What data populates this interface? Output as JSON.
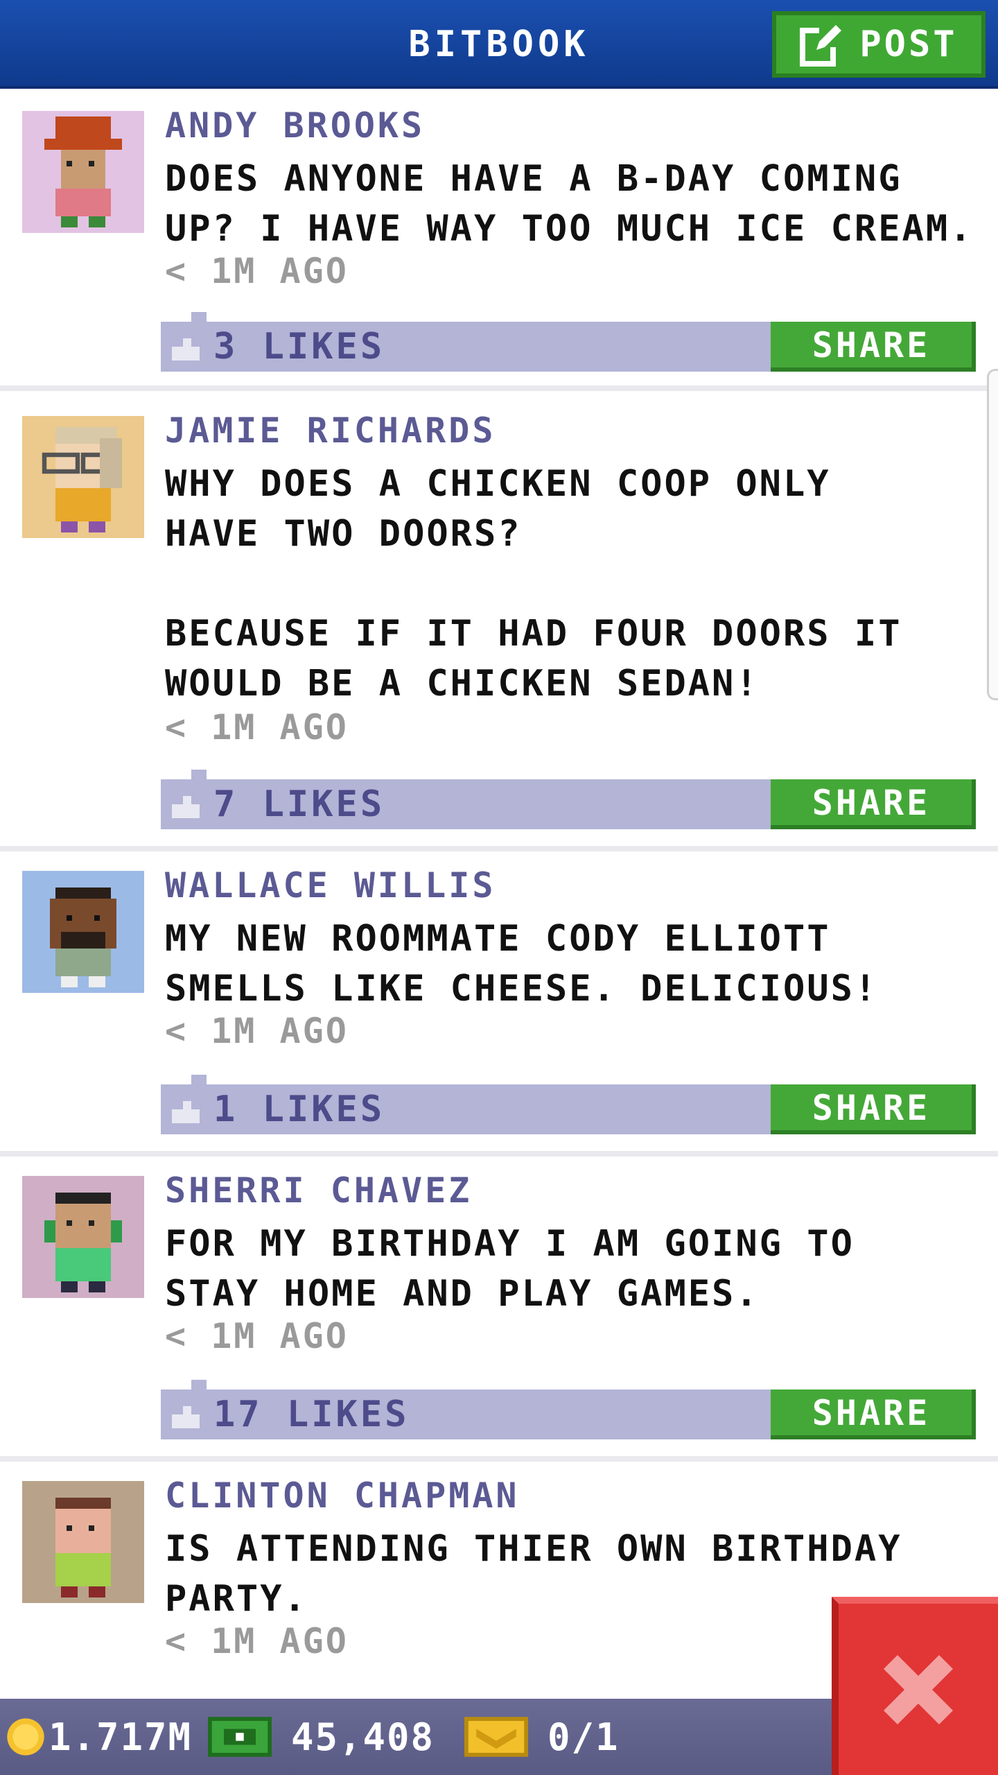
{
  "header": {
    "title": "BITBOOK",
    "post_label": "POST"
  },
  "posts": [
    {
      "author": "ANDY BROOKS",
      "message": "DOES ANYONE HAVE A B-DAY COMING\nUP? I HAVE WAY TOO MUCH ICE CREAM.",
      "time": "< 1M AGO",
      "likes": "3 LIKES",
      "share": "SHARE",
      "avatar_color": "#e2c3e3"
    },
    {
      "author": "JAMIE RICHARDS",
      "message": "WHY DOES A CHICKEN COOP ONLY\nHAVE TWO DOORS?\n\nBECAUSE IF IT HAD FOUR DOORS IT\nWOULD BE A CHICKEN SEDAN!",
      "time": "< 1M AGO",
      "likes": "7 LIKES",
      "share": "SHARE",
      "avatar_color": "#ecc98c"
    },
    {
      "author": "WALLACE WILLIS",
      "message": "MY NEW ROOMMATE CODY ELLIOTT\nSMELLS LIKE CHEESE. DELICIOUS!",
      "time": "< 1M AGO",
      "likes": "1 LIKES",
      "share": "SHARE",
      "avatar_color": "#9cbae6"
    },
    {
      "author": "SHERRI CHAVEZ",
      "message": "FOR MY BIRTHDAY I AM GOING TO\nSTAY HOME AND PLAY GAMES.",
      "time": "< 1M AGO",
      "likes": "17 LIKES",
      "share": "SHARE",
      "avatar_color": "#cfaec6"
    },
    {
      "author": "CLINTON CHAPMAN",
      "message": "IS ATTENDING THIER OWN BIRTHDAY\nPARTY.",
      "time": "< 1M AGO",
      "likes": "",
      "share": "",
      "avatar_color": "#b8a38a"
    }
  ],
  "footer": {
    "coins": "1.717M",
    "bux": "45,408",
    "tickets": "0/1"
  },
  "icons": {
    "post": "edit-icon",
    "like": "thumbs-up-icon",
    "coin": "coin-icon",
    "bux": "bux-icon",
    "ticket": "ticket-icon",
    "close": "close-icon"
  },
  "colors": {
    "header": "#1b4fb0",
    "accent_green": "#44a838",
    "likes_bar": "#b3b4d6",
    "author": "#5b5a94",
    "close": "#e23535",
    "bottom_bar": "#62638e"
  }
}
